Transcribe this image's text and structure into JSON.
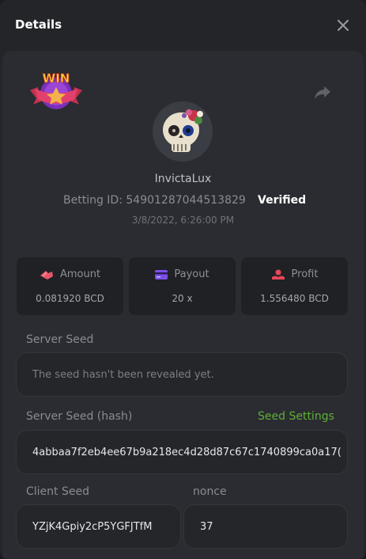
{
  "header": {
    "title": "Details",
    "close_icon": "close-icon"
  },
  "user": {
    "name": "InvictaLux",
    "betting_id_label": "Betting ID:",
    "betting_id": "549012870445138​29",
    "verified": "Verified",
    "timestamp": "3/8/2022, 6:26:00 PM",
    "badge_text": "WIN"
  },
  "stats": {
    "amount": {
      "label": "Amount",
      "value": "0.081920 BCD",
      "icon": "amount-icon",
      "color": "#e8576b"
    },
    "payout": {
      "label": "Payout",
      "value": "20 x",
      "icon": "card-icon",
      "color": "#7b4ee8"
    },
    "profit": {
      "label": "Profit",
      "value": "1.556480 BCD",
      "icon": "profit-icon",
      "color": "#e8465a"
    }
  },
  "server_seed": {
    "label": "Server Seed",
    "value": "The seed hasn't been revealed yet."
  },
  "server_seed_hash": {
    "label": "Server Seed (hash)",
    "link": "Seed Settings",
    "value": "4abbaa7f2eb4ee67b9a218ec4d28d87c67c1740899ca0a17("
  },
  "client_seed": {
    "label": "Client Seed",
    "value": "YZjK4Gpiy2cP5YGFJTfM"
  },
  "nonce": {
    "label": "nonce",
    "value": "37"
  },
  "colors": {
    "accent_green": "#5fae35",
    "verified": "#ffffff"
  }
}
